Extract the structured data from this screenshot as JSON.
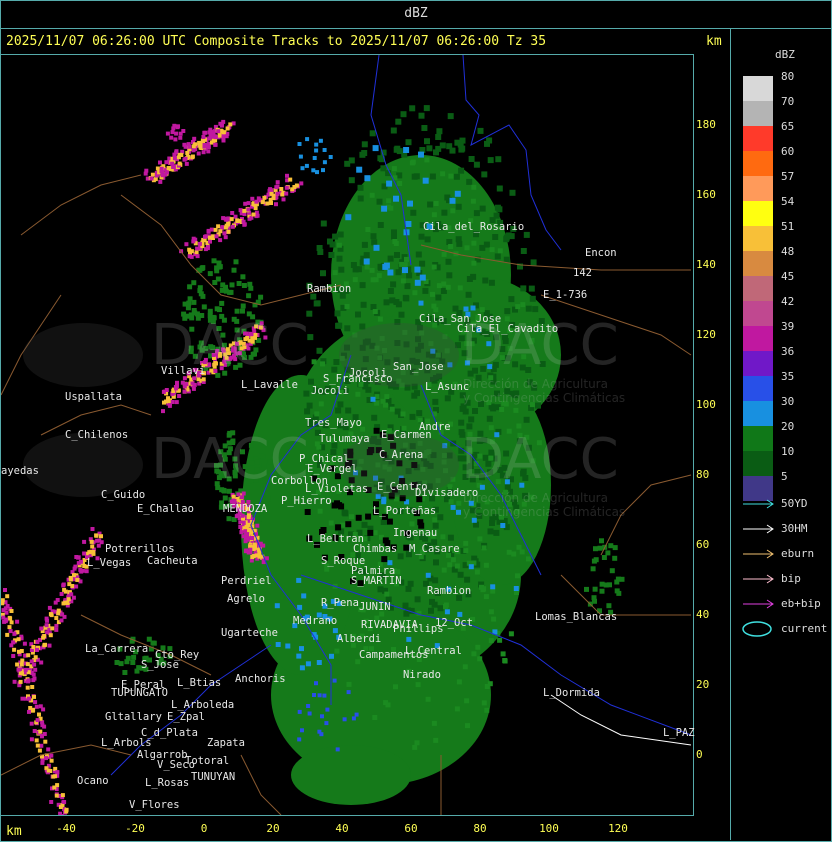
{
  "window_title": "dBZ",
  "header": {
    "text": "2025/11/07 06:26:00 UTC Composite Tracks to 2025/11/07 06:26:00 Tz 35",
    "km_label": "km"
  },
  "axes": {
    "km_label": "km",
    "y_ticks": [
      "180",
      "160",
      "140",
      "120",
      "100",
      "80",
      "60",
      "40",
      "20",
      "0"
    ],
    "x_ticks": [
      "-40",
      "-20",
      "0",
      "20",
      "40",
      "60",
      "80",
      "100",
      "120"
    ]
  },
  "legend": {
    "title": "dBZ",
    "scale": [
      {
        "label": "80",
        "color": "#d8d8d8"
      },
      {
        "label": "70",
        "color": "#b4b4b4"
      },
      {
        "label": "65",
        "color": "#ff3a2a"
      },
      {
        "label": "60",
        "color": "#ff6a10"
      },
      {
        "label": "57",
        "color": "#ff9a5a"
      },
      {
        "label": "54",
        "color": "#ffff10"
      },
      {
        "label": "51",
        "color": "#f8c038"
      },
      {
        "label": "48",
        "color": "#d88a40"
      },
      {
        "label": "45",
        "color": "#c06878"
      },
      {
        "label": "42",
        "color": "#c04890"
      },
      {
        "label": "39",
        "color": "#c018a0"
      },
      {
        "label": "36",
        "color": "#7018c8"
      },
      {
        "label": "35",
        "color": "#2850e8"
      },
      {
        "label": "30",
        "color": "#1890e0"
      },
      {
        "label": "20",
        "color": "#107818"
      },
      {
        "label": "10",
        "color": "#0a5c14"
      },
      {
        "label": "5",
        "color": "#403888"
      }
    ],
    "tracks": [
      {
        "label": "50YD",
        "color": "#40e0e0"
      },
      {
        "label": "30HM",
        "color": "#ffffff"
      },
      {
        "label": "eburn",
        "color": "#f0c070"
      },
      {
        "label": "bip",
        "color": "#ffc0d0"
      },
      {
        "label": "eb+bip",
        "color": "#e040e0"
      },
      {
        "label": "current",
        "color": "#40e0e0"
      }
    ]
  },
  "watermark": {
    "brand": "DACC",
    "line1": "Dirección de Agricultura",
    "line2": "y Contingencias Climáticas"
  },
  "places": [
    {
      "name": "Cila_del_Rosario"
    },
    {
      "name": "Encon"
    },
    {
      "name": "142"
    },
    {
      "name": "E_1-736"
    },
    {
      "name": "Rambion"
    },
    {
      "name": "Cila_San_Jose"
    },
    {
      "name": "Cila_El_Cavadito"
    },
    {
      "name": "Villavi"
    },
    {
      "name": "L_Lavalle"
    },
    {
      "name": "S_Francisco"
    },
    {
      "name": "Jocoli"
    },
    {
      "name": "San_Jose"
    },
    {
      "name": "L_Asunc"
    },
    {
      "name": "Uspallata"
    },
    {
      "name": "Tres_Mayo"
    },
    {
      "name": "E_Carmen"
    },
    {
      "name": "Andre"
    },
    {
      "name": "C_Chilenos"
    },
    {
      "name": "Tulumaya"
    },
    {
      "name": "C_Arena"
    },
    {
      "name": "ayedas"
    },
    {
      "name": "P_Chical"
    },
    {
      "name": "E_Vergel"
    },
    {
      "name": "Corbollon"
    },
    {
      "name": "L_Violetas"
    },
    {
      "name": "E_Centro"
    },
    {
      "name": "Divisadero"
    },
    {
      "name": "C_Guido"
    },
    {
      "name": "E_Challao"
    },
    {
      "name": "MENDOZA"
    },
    {
      "name": "P_Hierro"
    },
    {
      "name": "L_Porteñas"
    },
    {
      "name": "Ingenau"
    },
    {
      "name": "Potrerillos"
    },
    {
      "name": "L_Vegas"
    },
    {
      "name": "Cacheuta"
    },
    {
      "name": "L_Beltran"
    },
    {
      "name": "Chimbas"
    },
    {
      "name": "M_Casare"
    },
    {
      "name": "Perdriel"
    },
    {
      "name": "S_Roque"
    },
    {
      "name": "Palmira"
    },
    {
      "name": "S_MARTIN"
    },
    {
      "name": "Agrelo"
    },
    {
      "name": "R_Pena"
    },
    {
      "name": "JUNIN"
    },
    {
      "name": "Rambion"
    },
    {
      "name": "Medrano"
    },
    {
      "name": "RIVADAVIA"
    },
    {
      "name": "Phillips"
    },
    {
      "name": "12_Oct"
    },
    {
      "name": "Ugarteche"
    },
    {
      "name": "Anchoris"
    },
    {
      "name": "Alberdi"
    },
    {
      "name": "Lomas_Blancas"
    },
    {
      "name": "La_Carrera"
    },
    {
      "name": "Cto_Rey"
    },
    {
      "name": "S_Jose"
    },
    {
      "name": "Campamentos"
    },
    {
      "name": "L_Central"
    },
    {
      "name": "E_Peral"
    },
    {
      "name": "L_Btias"
    },
    {
      "name": "Nirado"
    },
    {
      "name": "TUPUNGATO"
    },
    {
      "name": "L_Arboleda"
    },
    {
      "name": "L_Dormida"
    },
    {
      "name": "Gltallary"
    },
    {
      "name": "E_Zpal"
    },
    {
      "name": "C_d_Plata"
    },
    {
      "name": "L_Arbols"
    },
    {
      "name": "Zapata"
    },
    {
      "name": "Algarrob"
    },
    {
      "name": "V_Seco"
    },
    {
      "name": "Totoral"
    },
    {
      "name": "TUNUYAN"
    },
    {
      "name": "L_Rosas"
    },
    {
      "name": "V_Flores"
    },
    {
      "name": "L_PAZ"
    },
    {
      "name": "Ocano"
    },
    {
      "name": "Jocoli"
    }
  ]
}
